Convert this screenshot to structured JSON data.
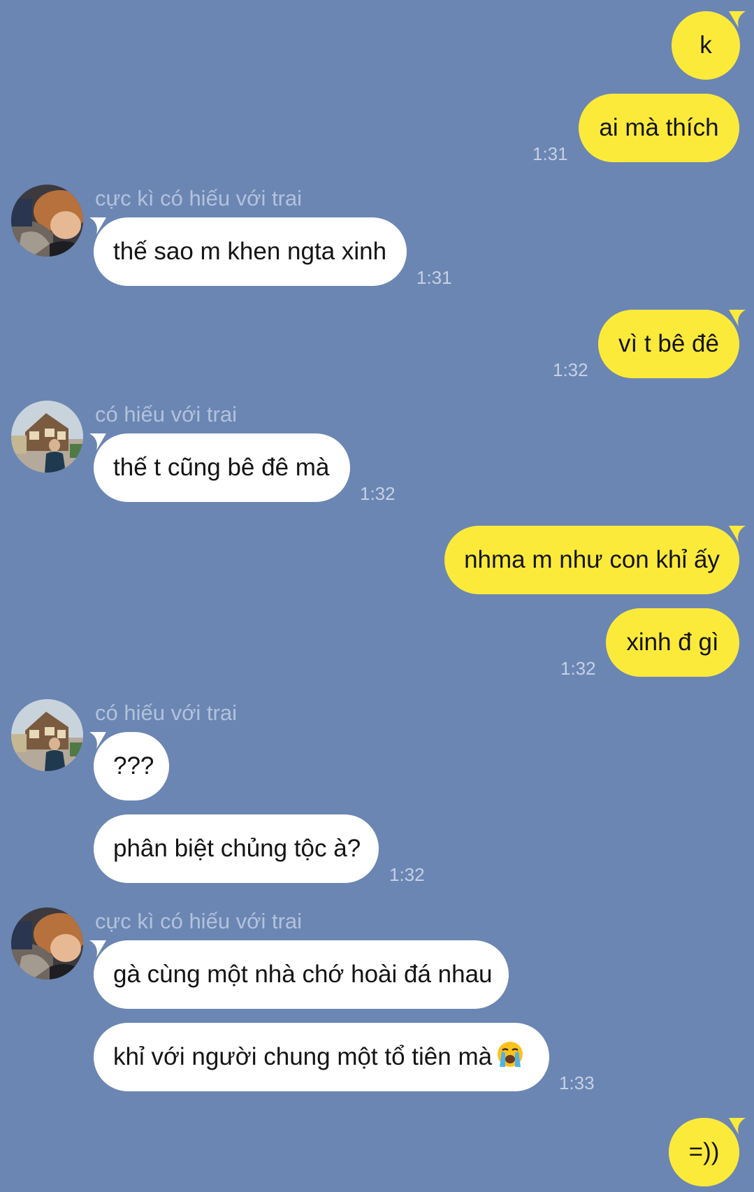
{
  "chat": {
    "messages": [
      {
        "side": "out",
        "text": "k"
      },
      {
        "side": "out",
        "text": "ai mà thích",
        "time": "1:31"
      },
      {
        "side": "in",
        "sender": "cực kì có hiếu với trai",
        "text": "thế sao m khen ngta xinh",
        "time": "1:31"
      },
      {
        "side": "out",
        "text": "vì t bê đê",
        "time": "1:32"
      },
      {
        "side": "in",
        "sender": "có hiếu với trai",
        "text": "thế t cũng bê đê mà",
        "time": "1:32"
      },
      {
        "side": "out",
        "text": "nhma m như con khỉ ấy"
      },
      {
        "side": "out",
        "text": "xinh đ gì",
        "time": "1:32"
      },
      {
        "side": "in",
        "sender": "có hiếu với trai",
        "text": "???"
      },
      {
        "side": "in",
        "text": "phân biệt chủng tộc à?",
        "time": "1:32"
      },
      {
        "side": "in",
        "sender": "cực kì có hiếu với trai",
        "text": "gà cùng một nhà chớ hoài đá nhau"
      },
      {
        "side": "in",
        "text": "khỉ với người chung một tổ tiên mà",
        "emoji": "loudly-crying-face-icon",
        "time": "1:33"
      },
      {
        "side": "out",
        "text": "=))"
      }
    ]
  },
  "colors": {
    "background": "#6b86b3",
    "outgoing_bubble": "#fcea3b",
    "incoming_bubble": "#ffffff",
    "sender_name": "#b3c2dc",
    "timestamp": "#c6d1e5"
  }
}
